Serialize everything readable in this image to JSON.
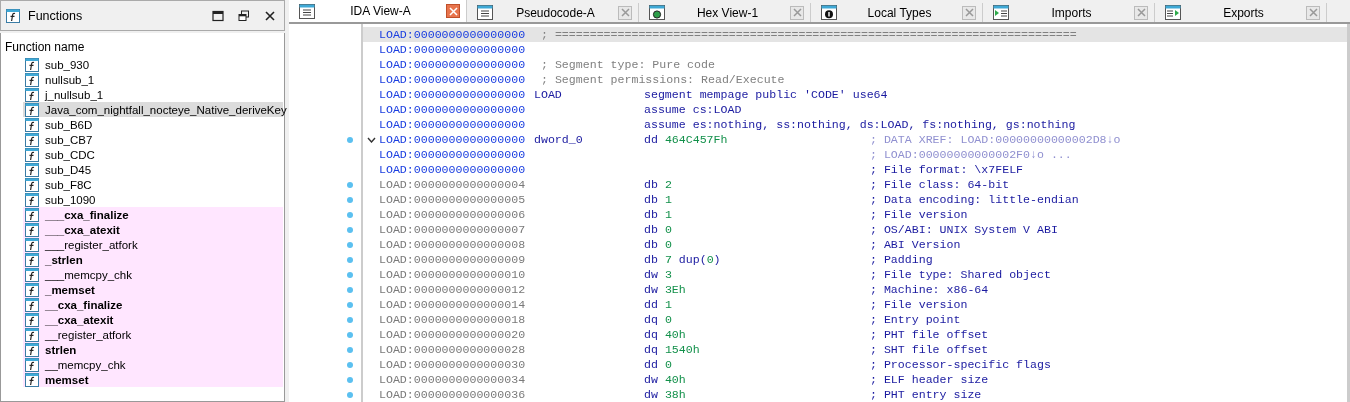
{
  "functions_panel": {
    "title": "Functions",
    "column_header": "Function name",
    "items": [
      {
        "name": "sub_930",
        "bold": false,
        "library": false,
        "selected": false
      },
      {
        "name": "nullsub_1",
        "bold": false,
        "library": false,
        "selected": false
      },
      {
        "name": "j_nullsub_1",
        "bold": false,
        "library": false,
        "selected": false
      },
      {
        "name": "Java_com_nightfall_nocteye_Native_deriveKey",
        "bold": false,
        "library": false,
        "selected": true
      },
      {
        "name": "sub_B6D",
        "bold": false,
        "library": false,
        "selected": false
      },
      {
        "name": "sub_CB7",
        "bold": false,
        "library": false,
        "selected": false
      },
      {
        "name": "sub_CDC",
        "bold": false,
        "library": false,
        "selected": false
      },
      {
        "name": "sub_D45",
        "bold": false,
        "library": false,
        "selected": false
      },
      {
        "name": "sub_F8C",
        "bold": false,
        "library": false,
        "selected": false
      },
      {
        "name": "sub_1090",
        "bold": false,
        "library": false,
        "selected": false
      },
      {
        "name": "___cxa_finalize",
        "bold": true,
        "library": true,
        "selected": false
      },
      {
        "name": "___cxa_atexit",
        "bold": true,
        "library": true,
        "selected": false
      },
      {
        "name": "___register_atfork",
        "bold": false,
        "library": true,
        "selected": false
      },
      {
        "name": "_strlen",
        "bold": true,
        "library": true,
        "selected": false
      },
      {
        "name": "___memcpy_chk",
        "bold": false,
        "library": true,
        "selected": false
      },
      {
        "name": "_memset",
        "bold": true,
        "library": true,
        "selected": false
      },
      {
        "name": "__cxa_finalize",
        "bold": true,
        "library": true,
        "selected": false
      },
      {
        "name": "__cxa_atexit",
        "bold": true,
        "library": true,
        "selected": false
      },
      {
        "name": "__register_atfork",
        "bold": false,
        "library": true,
        "selected": false
      },
      {
        "name": "strlen",
        "bold": true,
        "library": true,
        "selected": false
      },
      {
        "name": "__memcpy_chk",
        "bold": false,
        "library": true,
        "selected": false
      },
      {
        "name": "memset",
        "bold": true,
        "library": true,
        "selected": false
      }
    ]
  },
  "tabs": [
    {
      "label": "IDA View-A",
      "kind": "listing",
      "selected": true
    },
    {
      "label": "Pseudocode-A",
      "kind": "listing",
      "selected": false
    },
    {
      "label": "Hex View-1",
      "kind": "hex",
      "selected": false
    },
    {
      "label": "Local Types",
      "kind": "info",
      "selected": false
    },
    {
      "label": "Imports",
      "kind": "imports",
      "selected": false
    },
    {
      "label": "Exports",
      "kind": "exports",
      "selected": false
    }
  ],
  "listing": [
    {
      "address": "LOAD:0000000000000000",
      "kind": "segment",
      "selected": true,
      "breakpoint": false,
      "collapsible": false,
      "comment": "; ==========================================================================="
    },
    {
      "address": "LOAD:0000000000000000",
      "kind": "segment",
      "selected": false,
      "breakpoint": false,
      "collapsible": false
    },
    {
      "address": "LOAD:0000000000000000",
      "kind": "segment",
      "selected": false,
      "breakpoint": false,
      "collapsible": false,
      "comment": "; Segment type: Pure code"
    },
    {
      "address": "LOAD:0000000000000000",
      "kind": "segment",
      "selected": false,
      "breakpoint": false,
      "collapsible": false,
      "comment": "; Segment permissions: Read/Execute"
    },
    {
      "address": "LOAD:0000000000000000",
      "kind": "segment",
      "selected": false,
      "breakpoint": false,
      "collapsible": false,
      "label": "LOAD",
      "operands": [
        {
          "text": "segment mempage public 'CODE' use64",
          "kind": "keyword"
        }
      ]
    },
    {
      "address": "LOAD:0000000000000000",
      "kind": "segment",
      "selected": false,
      "breakpoint": false,
      "collapsible": false,
      "operands": [
        {
          "text": "assume cs:LOAD",
          "kind": "keyword"
        }
      ]
    },
    {
      "address": "LOAD:0000000000000000",
      "kind": "segment",
      "selected": false,
      "breakpoint": false,
      "collapsible": false,
      "operands": [
        {
          "text": "assume es:nothing, ss:nothing, ds:LOAD, fs:nothing, gs:nothing",
          "kind": "keyword"
        }
      ]
    },
    {
      "address": "LOAD:0000000000000000",
      "kind": "xref",
      "selected": false,
      "breakpoint": true,
      "collapsible": true,
      "label": "dword_0",
      "operands": [
        {
          "text": "dd ",
          "kind": "keyword"
        },
        {
          "text": "464C457Fh",
          "kind": "number"
        }
      ],
      "comment": "; DATA XREF: LOAD:00000000000002D8↓o"
    },
    {
      "address": "LOAD:0000000000000000",
      "kind": "xref",
      "selected": false,
      "breakpoint": false,
      "collapsible": false,
      "comment": "; LOAD:00000000000002F0↓o ..."
    },
    {
      "address": "LOAD:0000000000000000",
      "kind": "header",
      "selected": false,
      "breakpoint": false,
      "collapsible": false,
      "comment": "; File format: \\x7FELF"
    },
    {
      "address": "LOAD:0000000000000004",
      "kind": "field",
      "selected": false,
      "breakpoint": true,
      "collapsible": false,
      "operands": [
        {
          "text": "db ",
          "kind": "keyword"
        },
        {
          "text": "2",
          "kind": "number"
        }
      ],
      "comment": "; File class: 64-bit"
    },
    {
      "address": "LOAD:0000000000000005",
      "kind": "field",
      "selected": false,
      "breakpoint": true,
      "collapsible": false,
      "operands": [
        {
          "text": "db ",
          "kind": "keyword"
        },
        {
          "text": "1",
          "kind": "number"
        }
      ],
      "comment": "; Data encoding: little-endian"
    },
    {
      "address": "LOAD:0000000000000006",
      "kind": "field",
      "selected": false,
      "breakpoint": true,
      "collapsible": false,
      "operands": [
        {
          "text": "db ",
          "kind": "keyword"
        },
        {
          "text": "1",
          "kind": "number"
        }
      ],
      "comment": "; File version"
    },
    {
      "address": "LOAD:0000000000000007",
      "kind": "field",
      "selected": false,
      "breakpoint": true,
      "collapsible": false,
      "operands": [
        {
          "text": "db ",
          "kind": "keyword"
        },
        {
          "text": "0",
          "kind": "number"
        }
      ],
      "comment": "; OS/ABI: UNIX System V ABI"
    },
    {
      "address": "LOAD:0000000000000008",
      "kind": "field",
      "selected": false,
      "breakpoint": true,
      "collapsible": false,
      "operands": [
        {
          "text": "db ",
          "kind": "keyword"
        },
        {
          "text": "0",
          "kind": "number"
        }
      ],
      "comment": "; ABI Version"
    },
    {
      "address": "LOAD:0000000000000009",
      "kind": "field",
      "selected": false,
      "breakpoint": true,
      "collapsible": false,
      "operands": [
        {
          "text": "db ",
          "kind": "keyword"
        },
        {
          "text": "7",
          "kind": "number"
        },
        {
          "text": " dup(",
          "kind": "keyword"
        },
        {
          "text": "0",
          "kind": "number"
        },
        {
          "text": ")",
          "kind": "keyword"
        }
      ],
      "comment": "; Padding"
    },
    {
      "address": "LOAD:0000000000000010",
      "kind": "field",
      "selected": false,
      "breakpoint": true,
      "collapsible": false,
      "operands": [
        {
          "text": "dw ",
          "kind": "keyword"
        },
        {
          "text": "3",
          "kind": "number"
        }
      ],
      "comment": "; File type: Shared object"
    },
    {
      "address": "LOAD:0000000000000012",
      "kind": "field",
      "selected": false,
      "breakpoint": true,
      "collapsible": false,
      "operands": [
        {
          "text": "dw ",
          "kind": "keyword"
        },
        {
          "text": "3Eh",
          "kind": "number"
        }
      ],
      "comment": "; Machine: x86-64"
    },
    {
      "address": "LOAD:0000000000000014",
      "kind": "field",
      "selected": false,
      "breakpoint": true,
      "collapsible": false,
      "operands": [
        {
          "text": "dd ",
          "kind": "keyword"
        },
        {
          "text": "1",
          "kind": "number"
        }
      ],
      "comment": "; File version"
    },
    {
      "address": "LOAD:0000000000000018",
      "kind": "field",
      "selected": false,
      "breakpoint": true,
      "collapsible": false,
      "operands": [
        {
          "text": "dq ",
          "kind": "keyword"
        },
        {
          "text": "0",
          "kind": "number"
        }
      ],
      "comment": "; Entry point"
    },
    {
      "address": "LOAD:0000000000000020",
      "kind": "field",
      "selected": false,
      "breakpoint": true,
      "collapsible": false,
      "operands": [
        {
          "text": "dq ",
          "kind": "keyword"
        },
        {
          "text": "40h",
          "kind": "number"
        }
      ],
      "comment": "; PHT file offset"
    },
    {
      "address": "LOAD:0000000000000028",
      "kind": "field",
      "selected": false,
      "breakpoint": true,
      "collapsible": false,
      "operands": [
        {
          "text": "dq ",
          "kind": "keyword"
        },
        {
          "text": "1540h",
          "kind": "number"
        }
      ],
      "comment": "; SHT file offset"
    },
    {
      "address": "LOAD:0000000000000030",
      "kind": "field",
      "selected": false,
      "breakpoint": true,
      "collapsible": false,
      "operands": [
        {
          "text": "dd ",
          "kind": "keyword"
        },
        {
          "text": "0",
          "kind": "number"
        }
      ],
      "comment": "; Processor-specific flags"
    },
    {
      "address": "LOAD:0000000000000034",
      "kind": "field",
      "selected": false,
      "breakpoint": true,
      "collapsible": false,
      "operands": [
        {
          "text": "dw ",
          "kind": "keyword"
        },
        {
          "text": "40h",
          "kind": "number"
        }
      ],
      "comment": "; ELF header size"
    },
    {
      "address": "LOAD:0000000000000036",
      "kind": "field",
      "selected": false,
      "breakpoint": true,
      "collapsible": false,
      "operands": [
        {
          "text": "dw ",
          "kind": "keyword"
        },
        {
          "text": "38h",
          "kind": "number"
        }
      ],
      "comment": "; PHT entry size"
    }
  ]
}
